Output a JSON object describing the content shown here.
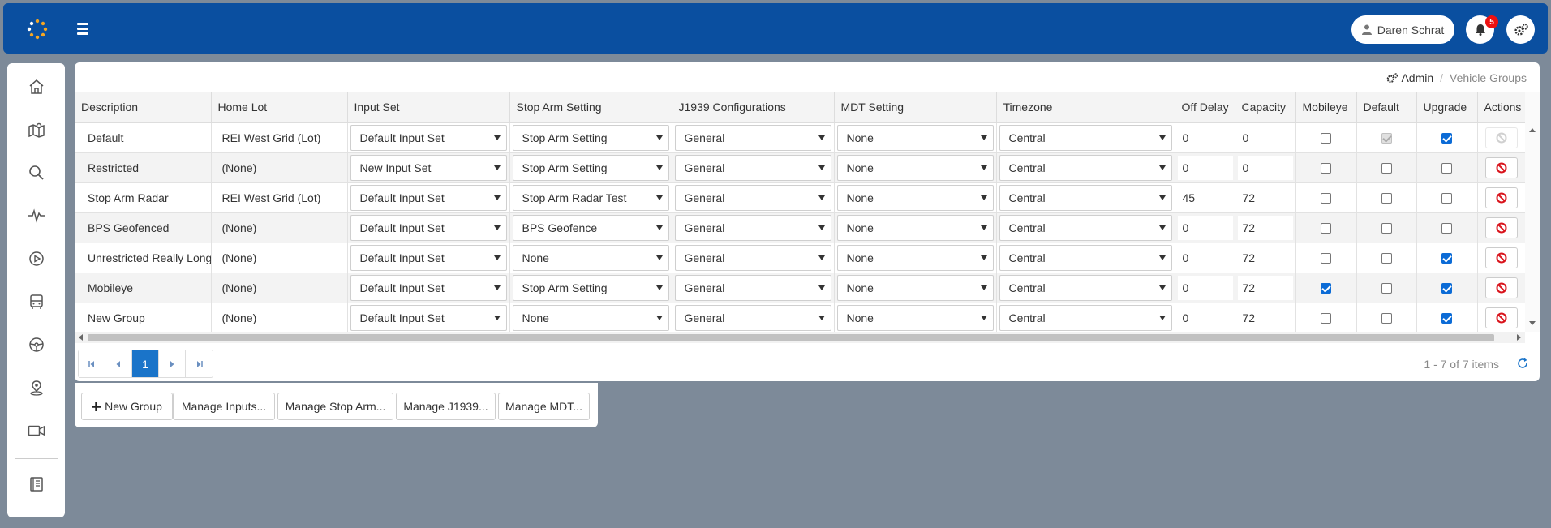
{
  "header": {
    "user_name": "Daren Schrat",
    "notification_count": "5"
  },
  "breadcrumb": {
    "root": "Admin",
    "sep": "/",
    "current": "Vehicle Groups"
  },
  "table": {
    "columns": [
      "Description",
      "Home Lot",
      "Input Set",
      "Stop Arm Setting",
      "J1939 Configurations",
      "MDT Setting",
      "Timezone",
      "Off Delay",
      "Capacity",
      "Mobileye",
      "Default",
      "Upgrade",
      "Actions"
    ],
    "rows": [
      {
        "description": "Default",
        "home_lot": "REI West Grid (Lot)",
        "input_set": "Default Input Set",
        "stop_arm": "Stop Arm Setting",
        "j1939": "General",
        "mdt": "None",
        "timezone": "Central",
        "off_delay": "0",
        "capacity": "0",
        "mobileye": false,
        "default": true,
        "default_disabled": true,
        "upgrade": true,
        "delete_disabled": true
      },
      {
        "description": "Restricted",
        "home_lot": "(None)",
        "input_set": "New Input Set",
        "stop_arm": "Stop Arm Setting",
        "j1939": "General",
        "mdt": "None",
        "timezone": "Central",
        "off_delay": "0",
        "capacity": "0",
        "mobileye": false,
        "default": false,
        "default_disabled": false,
        "upgrade": false,
        "delete_disabled": false
      },
      {
        "description": "Stop Arm Radar",
        "home_lot": "REI West Grid (Lot)",
        "input_set": "Default Input Set",
        "stop_arm": "Stop Arm Radar Test",
        "j1939": "General",
        "mdt": "None",
        "timezone": "Central",
        "off_delay": "45",
        "capacity": "72",
        "mobileye": false,
        "default": false,
        "default_disabled": false,
        "upgrade": false,
        "delete_disabled": false
      },
      {
        "description": "BPS Geofenced",
        "home_lot": "(None)",
        "input_set": "Default Input Set",
        "stop_arm": "BPS Geofence",
        "j1939": "General",
        "mdt": "None",
        "timezone": "Central",
        "off_delay": "0",
        "capacity": "72",
        "mobileye": false,
        "default": false,
        "default_disabled": false,
        "upgrade": false,
        "delete_disabled": false
      },
      {
        "description": "Unrestricted Really Long",
        "home_lot": "(None)",
        "input_set": "Default Input Set",
        "stop_arm": "None",
        "j1939": "General",
        "mdt": "None",
        "timezone": "Central",
        "off_delay": "0",
        "capacity": "72",
        "mobileye": false,
        "default": false,
        "default_disabled": false,
        "upgrade": true,
        "delete_disabled": false
      },
      {
        "description": "Mobileye",
        "home_lot": "(None)",
        "input_set": "Default Input Set",
        "stop_arm": "Stop Arm Setting",
        "j1939": "General",
        "mdt": "None",
        "timezone": "Central",
        "off_delay": "0",
        "capacity": "72",
        "mobileye": true,
        "default": false,
        "default_disabled": false,
        "upgrade": true,
        "delete_disabled": false
      },
      {
        "description": "New Group",
        "home_lot": "(None)",
        "input_set": "Default Input Set",
        "stop_arm": "None",
        "j1939": "General",
        "mdt": "None",
        "timezone": "Central",
        "off_delay": "0",
        "capacity": "72",
        "mobileye": false,
        "default": false,
        "default_disabled": false,
        "upgrade": true,
        "delete_disabled": false
      }
    ]
  },
  "pager": {
    "current_page": "1",
    "info": "1 - 7 of 7 items"
  },
  "actions": {
    "new_group": "New Group",
    "manage_inputs": "Manage Inputs...",
    "manage_stop_arm": "Manage Stop Arm...",
    "manage_j1939": "Manage J1939...",
    "manage_mdt": "Manage MDT..."
  },
  "colors": {
    "topbar": "#0a4fa0",
    "accent": "#1a74c9",
    "delete": "#d9141c",
    "background": "#7d8a99"
  },
  "sidebar_icons": [
    "home-icon",
    "map-icon",
    "search-icon",
    "pulse-icon",
    "play-icon",
    "bus-icon",
    "steering-wheel-icon",
    "location-pin-icon",
    "video-camera-icon",
    "book-icon"
  ]
}
